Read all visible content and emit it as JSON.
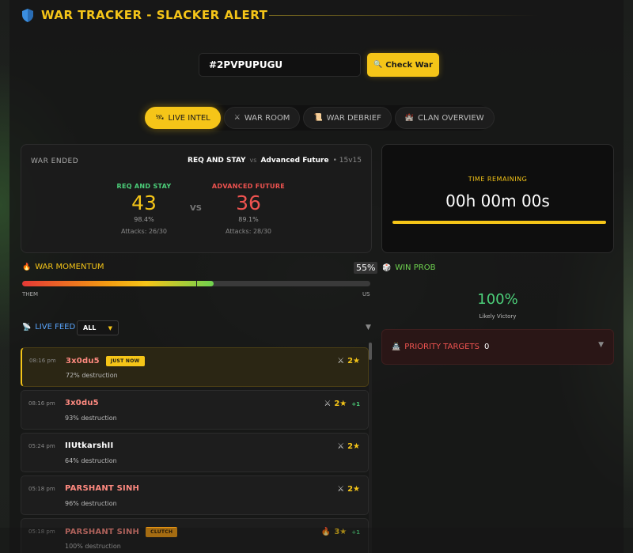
{
  "header": {
    "title": "WAR TRACKER - SLACKER ALERT",
    "icon": "shield-icon"
  },
  "search": {
    "value": "#2PVPUPUGU",
    "button_label": "Check War",
    "button_icon": "magnifier-icon"
  },
  "tabs": [
    {
      "label": "LIVE INTEL",
      "icon": "satellite-icon",
      "active": true
    },
    {
      "label": "WAR ROOM",
      "icon": "crossed-swords-icon",
      "active": false
    },
    {
      "label": "WAR DEBRIEF",
      "icon": "scroll-icon",
      "active": false
    },
    {
      "label": "CLAN OVERVIEW",
      "icon": "castle-icon",
      "active": false
    }
  ],
  "war": {
    "status": "WAR ENDED",
    "clan": "REQ AND STAY",
    "vs": "vs",
    "opponent": "Advanced Future",
    "size": "• 15v15",
    "left": {
      "name": "REQ AND STAY",
      "stars": "43",
      "pct": "98.4%",
      "attacks": "Attacks: 26/30",
      "color": "#4cd07a",
      "star_color": "#f5c518"
    },
    "vs_big": "VS",
    "right": {
      "name": "ADVANCED FUTURE",
      "stars": "36",
      "pct": "89.1%",
      "attacks": "Attacks: 28/30",
      "color": "#ef5350",
      "star_color": "#ef5350"
    }
  },
  "timer": {
    "label": "TIME REMAINING",
    "value": "00h 00m 00s"
  },
  "momentum": {
    "title": "WAR MOMENTUM",
    "percent_label": "55%",
    "fill_fraction": 0.55,
    "them": "THEM",
    "us": "US"
  },
  "win_prob": {
    "title": "WIN PROB",
    "value": "100%",
    "subtitle": "Likely Victory"
  },
  "priority": {
    "title": "PRIORITY TARGETS",
    "count": "0"
  },
  "feed": {
    "title": "LIVE FEED",
    "filter": "ALL",
    "items": [
      {
        "time": "08:16 pm",
        "player": "3x0du5",
        "badge": "JUST NOW",
        "badge_type": "now",
        "destruction": "72% destruction",
        "stars": "2★",
        "icon": "crossed-swords-icon",
        "delta": "",
        "highlight": true,
        "name_color": "#ff8a80"
      },
      {
        "time": "08:16 pm",
        "player": "3x0du5",
        "badge": "",
        "badge_type": "",
        "destruction": "93% destruction",
        "stars": "2★",
        "icon": "crossed-swords-icon",
        "delta": "+1",
        "highlight": false,
        "name_color": "#ff8a80"
      },
      {
        "time": "05:24 pm",
        "player": "IIUtkarshII",
        "badge": "",
        "badge_type": "",
        "destruction": "64% destruction",
        "stars": "2★",
        "icon": "crossed-swords-icon",
        "delta": "",
        "highlight": false,
        "name_color": "#ffffff"
      },
      {
        "time": "05:18 pm",
        "player": "PARSHANT SINH",
        "badge": "",
        "badge_type": "",
        "destruction": "96% destruction",
        "stars": "2★",
        "icon": "crossed-swords-icon",
        "delta": "",
        "highlight": false,
        "name_color": "#ff8a80"
      },
      {
        "time": "05:18 pm",
        "player": "PARSHANT SINH",
        "badge": "CLUTCH",
        "badge_type": "clutch",
        "destruction": "100% destruction",
        "stars": "3★",
        "icon": "fire-icon",
        "delta": "+1",
        "highlight": false,
        "name_color": "#ff8a80"
      }
    ]
  }
}
